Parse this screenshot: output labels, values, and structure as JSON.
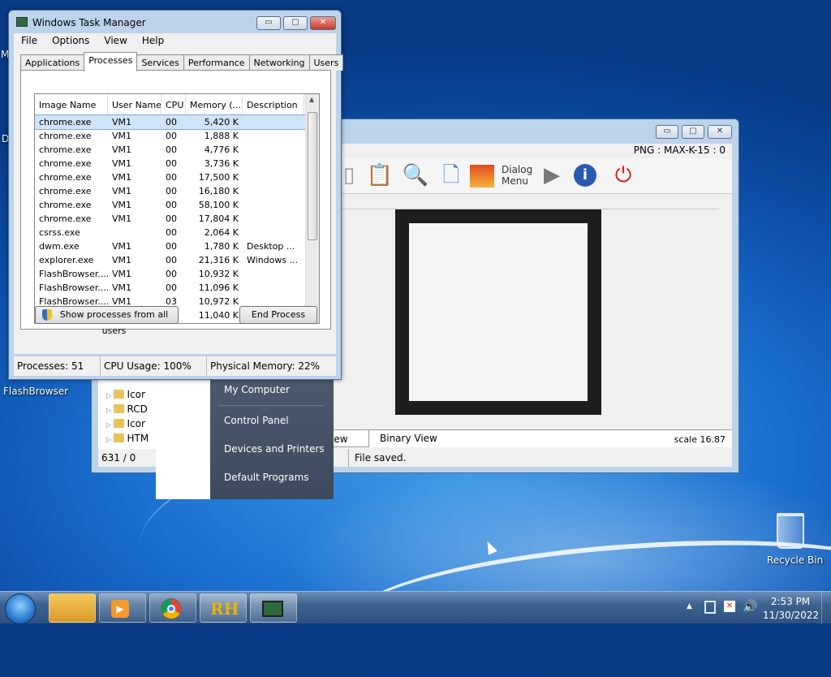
{
  "task_manager": {
    "title": "Windows Task Manager",
    "menu": [
      "File",
      "Options",
      "View",
      "Help"
    ],
    "tabs": [
      "Applications",
      "Processes",
      "Services",
      "Performance",
      "Networking",
      "Users"
    ],
    "columns": [
      "Image Name",
      "User Name",
      "CPU",
      "Memory (...",
      "Description"
    ],
    "rows": [
      [
        "chrome.exe",
        "VM1",
        "00",
        "5,420 K",
        ""
      ],
      [
        "chrome.exe",
        "VM1",
        "00",
        "1,888 K",
        ""
      ],
      [
        "chrome.exe",
        "VM1",
        "00",
        "4,776 K",
        ""
      ],
      [
        "chrome.exe",
        "VM1",
        "00",
        "3,736 K",
        ""
      ],
      [
        "chrome.exe",
        "VM1",
        "00",
        "17,500 K",
        ""
      ],
      [
        "chrome.exe",
        "VM1",
        "00",
        "16,180 K",
        ""
      ],
      [
        "chrome.exe",
        "VM1",
        "00",
        "58,100 K",
        ""
      ],
      [
        "chrome.exe",
        "VM1",
        "00",
        "17,804 K",
        ""
      ],
      [
        "csrss.exe",
        "",
        "00",
        "2,064 K",
        ""
      ],
      [
        "dwm.exe",
        "VM1",
        "00",
        "1,780 K",
        "Desktop ..."
      ],
      [
        "explorer.exe",
        "VM1",
        "00",
        "21,316 K",
        "Windows ..."
      ],
      [
        "FlashBrowser....",
        "VM1",
        "00",
        "10,932 K",
        ""
      ],
      [
        "FlashBrowser....",
        "VM1",
        "00",
        "11,096 K",
        ""
      ],
      [
        "FlashBrowser....",
        "VM1",
        "03",
        "10,972 K",
        ""
      ],
      [
        "FlashBrowser....",
        "VM1",
        "00",
        "11,040 K",
        ""
      ]
    ],
    "show_all_label": "Show processes from all users",
    "end_process_label": "End Process",
    "status_processes": "Processes: 51",
    "status_cpu": "CPU Usage: 100%",
    "status_memory": "Physical Memory: 22%",
    "btn_min": "▭",
    "btn_max": "▢",
    "btn_close": "✕"
  },
  "editor": {
    "png_info": "PNG : MAX-K-15 : 0",
    "dialog_menu_label": "Dialog Menu",
    "tab_view": "iew",
    "tab_binary": "Binary View",
    "scale": "scale 16.87",
    "coords": "631 / 0",
    "status": "File saved.",
    "tree_items": [
      "Icor",
      "RCD",
      "Icor",
      "HTM"
    ]
  },
  "start_menu": {
    "items": [
      "My Computer",
      "Control Panel",
      "Devices and Printers",
      "Default Programs"
    ]
  },
  "desktop": {
    "flashbrowser_label": "FlashBrowser",
    "recycle_label": "Recycle Bin",
    "edge_letter_1": "M",
    "edge_letter_2": "D"
  },
  "taskbar": {
    "time": "2:53 PM",
    "date": "11/30/2022",
    "rh_label": "RH"
  }
}
